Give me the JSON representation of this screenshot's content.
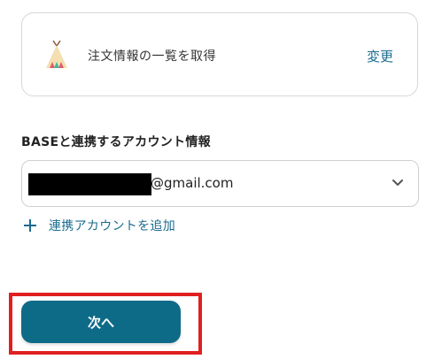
{
  "action_card": {
    "app_icon": "teepee-icon",
    "label": "注文情報の一覧を取得",
    "change_label": "変更"
  },
  "account": {
    "section_label": "BASEと連携するアカウント情報",
    "selected_value": "@gmail.com",
    "dropdown_icon": "chevron-down-icon",
    "add_label": "連携アカウントを追加",
    "add_icon": "plus-icon"
  },
  "footer": {
    "next_label": "次へ"
  },
  "colors": {
    "accent": "#1a6b8f",
    "button": "#0e6b88",
    "highlight": "#e02020"
  }
}
